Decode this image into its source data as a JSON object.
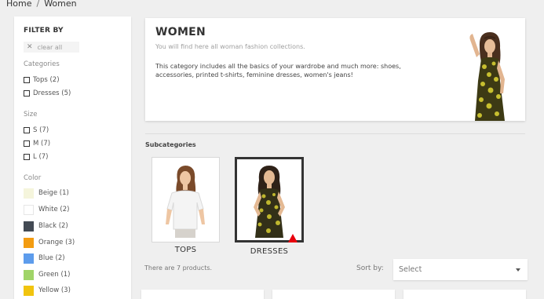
{
  "breadcrumb": {
    "home": "Home",
    "separator": "/",
    "current": "Women"
  },
  "sidebar": {
    "title": "FILTER BY",
    "clear_icon": "close-icon",
    "clear_label": "clear all",
    "categories": {
      "title": "Categories",
      "items": [
        "Tops (2)",
        "Dresses (5)"
      ]
    },
    "size": {
      "title": "Size",
      "items": [
        "S (7)",
        "M (7)",
        "L (7)"
      ]
    },
    "color": {
      "title": "Color",
      "items": [
        {
          "label": "Beige (1)",
          "color": "#f5f5dc"
        },
        {
          "label": "White (2)",
          "color": "#ffffff"
        },
        {
          "label": "Black (2)",
          "color": "#434a54"
        },
        {
          "label": "Orange (3)",
          "color": "#f39c11"
        },
        {
          "label": "Blue (2)",
          "color": "#5d9cec"
        },
        {
          "label": "Green (1)",
          "color": "#a0d468"
        },
        {
          "label": "Yellow (3)",
          "color": "#f1c40f"
        }
      ]
    }
  },
  "category": {
    "title": "WOMEN",
    "subtitle": "You will find here all woman fashion collections.",
    "description": "This category includes all the basics of your wardrobe and much more: shoes, accessories, printed t-shirts, feminine dresses, women's jeans!"
  },
  "subcategories": {
    "title": "Subcategories",
    "items": [
      {
        "name": "TOPS"
      },
      {
        "name": "DRESSES"
      }
    ]
  },
  "listing": {
    "count_text": "There are 7 products.",
    "sort_label": "Sort by:",
    "sort_value": "Select",
    "sort_icon": "chevron-down-icon"
  },
  "cursor": {
    "color": "#e8000d"
  }
}
